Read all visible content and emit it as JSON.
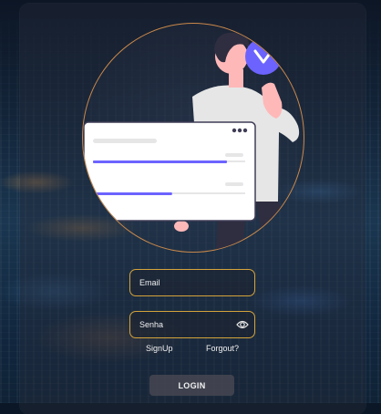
{
  "login_form": {
    "email": {
      "placeholder": "Email",
      "value": ""
    },
    "password": {
      "placeholder": "Senha",
      "value": ""
    },
    "show_password_icon": "eye-icon",
    "signup_label": "SignUp",
    "forgot_label": "Forgout?",
    "login_label": "LOGIN"
  },
  "colors": {
    "field_border": "#d4a33b",
    "hero_border": "#c9884a",
    "accent_purple": "#6c63ff",
    "card_background": "rgba(40,45,60,0.38)"
  },
  "illustration": {
    "progress_bar_1": 0.88,
    "progress_bar_2": 0.52
  }
}
